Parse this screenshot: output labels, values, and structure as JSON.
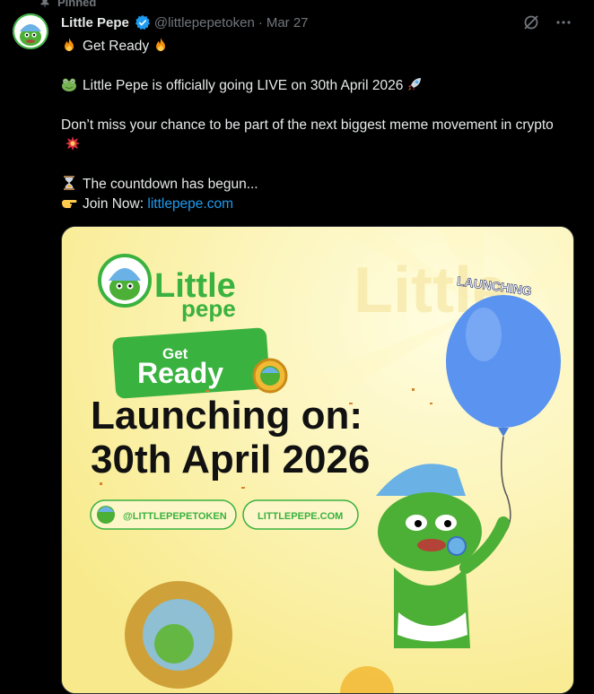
{
  "pinned_label": "Pinned",
  "author": {
    "name": "Little Pepe",
    "handle": "@littlepepetoken",
    "separator": "·",
    "date": "Mar 27"
  },
  "tweet": {
    "line1": "Get Ready",
    "line2": "Little Pepe is officially going LIVE on 30th April 2026",
    "line3": "Don’t miss your chance to be part of the next biggest meme movement in crypto",
    "line4": "The countdown has begun...",
    "line5_prefix": "Join Now:",
    "link": "littlepepe.com"
  },
  "media": {
    "brand_top": "Little",
    "brand_bottom": "pepe",
    "badge_top": "Get",
    "badge_bottom": "Ready",
    "headline1": "Launching on:",
    "headline2": "30th April 2026",
    "balloon_label": "LAUNCHING",
    "pill1": "@LITTLEPEPETOKEN",
    "pill2": "LITTLEPEPE.COM"
  },
  "colors": {
    "background": "#000000",
    "link": "#1d9bf0",
    "muted": "#71767b",
    "media_bg": "#fbf1a5",
    "brand_green": "#3ab23f",
    "balloon_blue": "#5a93f0"
  }
}
